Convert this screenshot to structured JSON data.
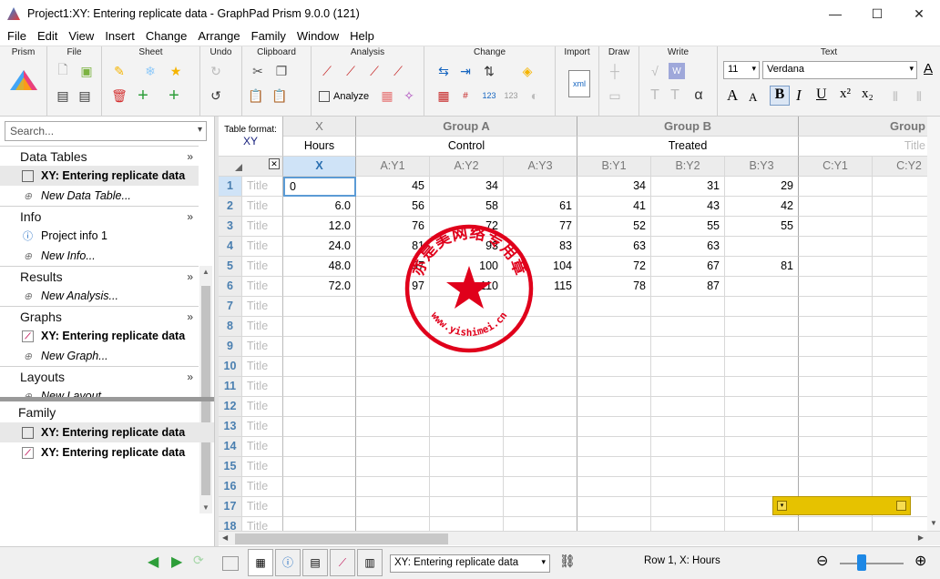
{
  "window": {
    "title": "Project1:XY: Entering replicate data - GraphPad Prism 9.0.0 (121)",
    "controls": [
      "—",
      "☐",
      "✕"
    ]
  },
  "menu": [
    "File",
    "Edit",
    "View",
    "Insert",
    "Change",
    "Arrange",
    "Family",
    "Window",
    "Help"
  ],
  "ribbon": {
    "groups": [
      "Prism",
      "File",
      "Sheet",
      "Undo",
      "Clipboard",
      "Analysis",
      "Change",
      "Import",
      "Draw",
      "Write",
      "Text"
    ],
    "analyze_label": "Analyze",
    "font_size": "11",
    "font_name": "Verdana",
    "text_buttons": [
      "A",
      "A",
      "B",
      "I",
      "U",
      "x²",
      "x₂"
    ]
  },
  "sidebar": {
    "search_placeholder": "Search...",
    "sections": [
      {
        "title": "Data Tables",
        "items": [
          {
            "label": "XY: Entering replicate data",
            "kind": "table",
            "selected": true
          },
          {
            "label": "New Data Table...",
            "kind": "new"
          }
        ]
      },
      {
        "title": "Info",
        "items": [
          {
            "label": "Project info 1",
            "kind": "info"
          },
          {
            "label": "New Info...",
            "kind": "new"
          }
        ]
      },
      {
        "title": "Results",
        "items": [
          {
            "label": "New Analysis...",
            "kind": "new"
          }
        ]
      },
      {
        "title": "Graphs",
        "items": [
          {
            "label": "XY: Entering replicate data",
            "kind": "graph"
          },
          {
            "label": "New Graph...",
            "kind": "new"
          }
        ]
      },
      {
        "title": "Layouts",
        "items": [
          {
            "label": "New Layout...",
            "kind": "new"
          }
        ]
      }
    ],
    "family": {
      "title": "Family",
      "items": [
        "XY: Entering replicate data",
        "XY: Entering replicate data"
      ]
    }
  },
  "table": {
    "format_label": "Table format:",
    "format_value": "XY",
    "x_title": "X",
    "x_subtitle": "Hours",
    "groups": [
      {
        "name": "Group A",
        "title": "Control",
        "cols": [
          "A:Y1",
          "A:Y2",
          "A:Y3"
        ]
      },
      {
        "name": "Group B",
        "title": "Treated",
        "cols": [
          "B:Y1",
          "B:Y2",
          "B:Y3"
        ]
      },
      {
        "name": "Group",
        "title": "Title",
        "cols": [
          "C:Y1",
          "C:Y2"
        ]
      }
    ],
    "x_col_label": "X",
    "row_title_placeholder": "Title",
    "rows": [
      [
        "0",
        "45",
        "34",
        "",
        "34",
        "31",
        "29"
      ],
      [
        "6.0",
        "56",
        "58",
        "61",
        "41",
        "43",
        "42"
      ],
      [
        "12.0",
        "76",
        "72",
        "77",
        "52",
        "55",
        "55"
      ],
      [
        "24.0",
        "81",
        "93",
        "83",
        "63",
        "63",
        ""
      ],
      [
        "48.0",
        "97",
        "100",
        "104",
        "72",
        "67",
        "81"
      ],
      [
        "72.0",
        "97",
        "110",
        "115",
        "78",
        "87",
        ""
      ]
    ],
    "row_count": 18
  },
  "stamp": {
    "text": "亦是美网络专用章",
    "url": "www.yishimei.cn"
  },
  "statusbar": {
    "sheet_select": "XY: Entering replicate data",
    "position": "Row 1, X: Hours"
  }
}
